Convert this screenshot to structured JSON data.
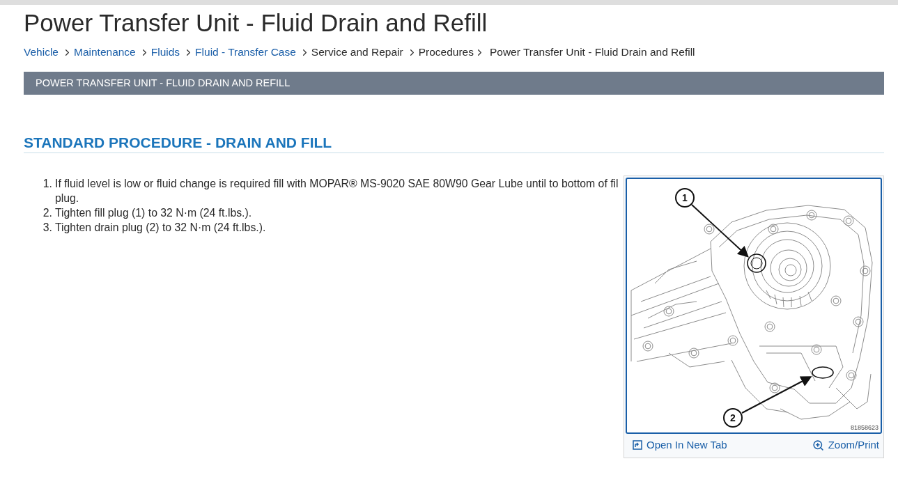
{
  "page_title": "Power Transfer Unit - Fluid Drain and Refill",
  "breadcrumb": [
    {
      "label": "Vehicle",
      "link": true
    },
    {
      "label": "Maintenance",
      "link": true
    },
    {
      "label": "Fluids",
      "link": true
    },
    {
      "label": "Fluid - Transfer Case",
      "link": true
    },
    {
      "label": "Service and Repair",
      "link": false
    },
    {
      "label": "Procedures",
      "link": false
    },
    {
      "label": "Power Transfer Unit - Fluid Drain and Refill",
      "link": false
    }
  ],
  "section_bar": {
    "title": "POWER TRANSFER UNIT - FLUID DRAIN AND REFILL"
  },
  "procedure": {
    "heading": "STANDARD PROCEDURE - DRAIN AND FILL",
    "steps": [
      {
        "number": "1.",
        "text": "If fluid level is low or fluid change is required fill with MOPAR® MS-9020 SAE 80W90 Gear Lube until to bottom of fil plug."
      },
      {
        "number": "2.",
        "text": "Tighten fill plug (1) to 32 N·m (24 ft.lbs.)."
      },
      {
        "number": "3.",
        "text": "Tighten drain plug (2) to 32 N·m (24 ft.lbs.)."
      }
    ]
  },
  "figure": {
    "callouts": [
      "1",
      "2"
    ],
    "figure_id": "81858623",
    "actions": [
      {
        "label": "Open In New Tab",
        "kind": "open"
      },
      {
        "label": "Zoom/Print",
        "kind": "zoom"
      }
    ]
  }
}
